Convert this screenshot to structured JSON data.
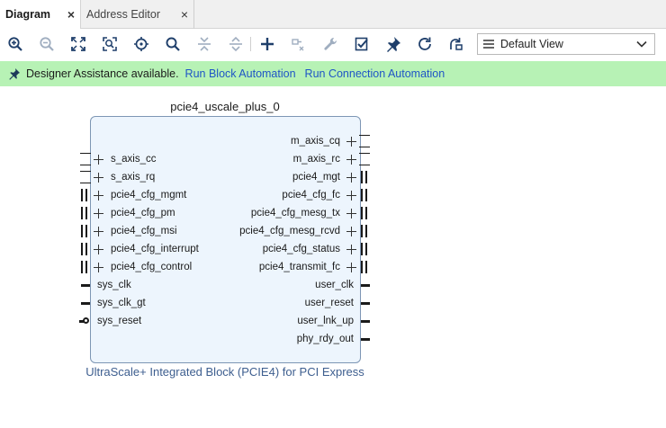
{
  "tabs": [
    {
      "label": "Diagram",
      "active": true
    },
    {
      "label": "Address Editor",
      "active": false
    }
  ],
  "toolbar": {
    "icons": [
      "zoom-in",
      "zoom-out",
      "zoom-fit",
      "zoom-area",
      "center",
      "search",
      "collapse-all",
      "expand-all",
      "add-ip",
      "make-connection",
      "properties-wrench",
      "validate-design",
      "pin",
      "refresh",
      "regenerate-layout"
    ],
    "view_selector": {
      "value": "Default View"
    }
  },
  "banner": {
    "message": "Designer Assistance available.",
    "link_block": "Run Block Automation",
    "link_connection": "Run Connection Automation",
    "color": "#b7f2b5"
  },
  "block": {
    "instance_name": "pcie4_uscale_plus_0",
    "ip_name": "UltraScale+ Integrated Block (PCIE4) for PCI Express",
    "left_ports": [
      "s_axis_cc",
      "s_axis_rq",
      "pcie4_cfg_mgmt",
      "pcie4_cfg_pm",
      "pcie4_cfg_msi",
      "pcie4_cfg_interrupt",
      "pcie4_cfg_control",
      "sys_clk",
      "sys_clk_gt",
      "sys_reset"
    ],
    "right_ports": [
      "m_axis_cq",
      "m_axis_rc",
      "pcie4_mgt",
      "pcie4_cfg_fc",
      "pcie4_cfg_mesg_tx",
      "pcie4_cfg_mesg_rcvd",
      "pcie4_cfg_status",
      "pcie4_transmit_fc",
      "user_clk",
      "user_reset",
      "user_lnk_up",
      "phy_rdy_out"
    ],
    "fill_color": "#edf5fd",
    "border_color": "#7d96b4"
  }
}
